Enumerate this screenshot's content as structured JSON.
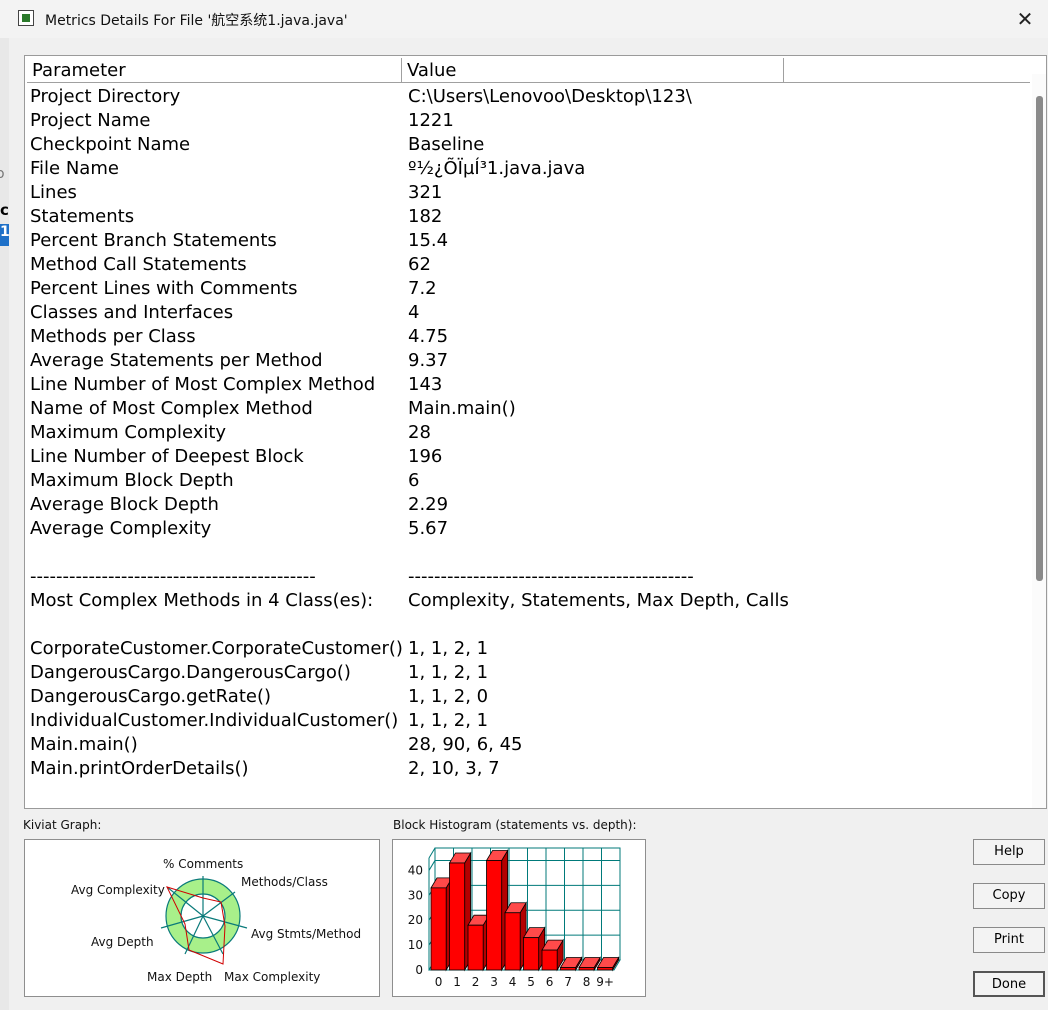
{
  "window": {
    "title": "Metrics Details For File '航空系统1.java.java'",
    "close_glyph": "✕"
  },
  "edge": {
    "c": "c",
    "one": "1",
    "o": "o"
  },
  "table": {
    "headers": [
      "Parameter",
      "Value"
    ],
    "rows": [
      [
        "Project Directory",
        "C:\\Users\\Lenovoo\\Desktop\\123\\"
      ],
      [
        "Project Name",
        "1221"
      ],
      [
        "Checkpoint Name",
        "Baseline"
      ],
      [
        "File Name",
        "º½¿ÕÏµÍ³1.java.java"
      ],
      [
        "Lines",
        "321"
      ],
      [
        "Statements",
        "182"
      ],
      [
        "Percent Branch Statements",
        "15.4"
      ],
      [
        "Method Call Statements",
        "62"
      ],
      [
        "Percent Lines with Comments",
        "7.2"
      ],
      [
        "Classes and Interfaces",
        "4"
      ],
      [
        "Methods per Class",
        "4.75"
      ],
      [
        "Average Statements per Method",
        "9.37"
      ],
      [
        "Line Number of Most Complex Method",
        "143"
      ],
      [
        "Name of Most Complex Method",
        "Main.main()"
      ],
      [
        "Maximum Complexity",
        "28"
      ],
      [
        "Line Number of Deepest Block",
        "196"
      ],
      [
        "Maximum Block Depth",
        "6"
      ],
      [
        "Average Block Depth",
        "2.29"
      ],
      [
        "Average Complexity",
        "5.67"
      ],
      [
        "",
        ""
      ],
      [
        "--------------------------------------------",
        "--------------------------------------------"
      ],
      [
        "Most Complex Methods in 4 Class(es):",
        "Complexity, Statements, Max Depth, Calls"
      ],
      [
        "",
        ""
      ],
      [
        "CorporateCustomer.CorporateCustomer()",
        "1, 1, 2, 1"
      ],
      [
        "DangerousCargo.DangerousCargo()",
        "1, 1, 2, 1"
      ],
      [
        "DangerousCargo.getRate()",
        "1, 1, 2, 0"
      ],
      [
        "IndividualCustomer.IndividualCustomer()",
        "1, 1, 2, 1"
      ],
      [
        "Main.main()",
        "28, 90, 6, 45"
      ],
      [
        "Main.printOrderDetails()",
        "2, 10, 3, 7"
      ]
    ]
  },
  "kiviat": {
    "label": "Kiviat Graph:",
    "axes": [
      "% Comments",
      "Methods/Class",
      "Avg Stmts/Method",
      "Max Complexity",
      "Max Depth",
      "Avg Depth",
      "Avg Complexity"
    ]
  },
  "histogram": {
    "label": "Block Histogram (statements vs. depth):",
    "colors": {
      "bar": "#ff0000",
      "grid": "#007a7a"
    },
    "chart_data": {
      "type": "bar",
      "categories": [
        "0",
        "1",
        "2",
        "3",
        "4",
        "5",
        "6",
        "7",
        "8",
        "9+"
      ],
      "values": [
        33,
        43,
        18,
        44,
        23,
        13,
        8,
        1,
        1,
        1
      ],
      "ylim": [
        0,
        45
      ],
      "yticks": [
        "0",
        "10",
        "20",
        "30",
        "40"
      ]
    }
  },
  "buttons": {
    "help": "Help",
    "copy": "Copy",
    "print": "Print",
    "done": "Done"
  }
}
